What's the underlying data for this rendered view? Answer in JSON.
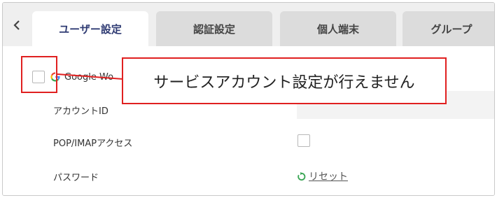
{
  "tabs": [
    {
      "label": "ユーザー設定",
      "active": true
    },
    {
      "label": "認証設定",
      "active": false
    },
    {
      "label": "個人端末",
      "active": false
    },
    {
      "label": "グループ",
      "active": false
    }
  ],
  "icons": {
    "back": "chevron-left-icon",
    "google": "google-icon",
    "reset": "refresh-icon"
  },
  "google_workspace": {
    "label": "Google Wo"
  },
  "fields": {
    "account_id": {
      "label": "アカウントID",
      "value": ""
    },
    "pop_imap": {
      "label": "POP/IMAPアクセス"
    },
    "password": {
      "label": "パスワード",
      "reset_label": "リセット"
    }
  },
  "annotation": {
    "text": "サービスアカウント設定が行えません",
    "color": "#e02020"
  },
  "colors": {
    "active_tab_text": "#2f3b73",
    "reset_icon": "#3aa655"
  }
}
